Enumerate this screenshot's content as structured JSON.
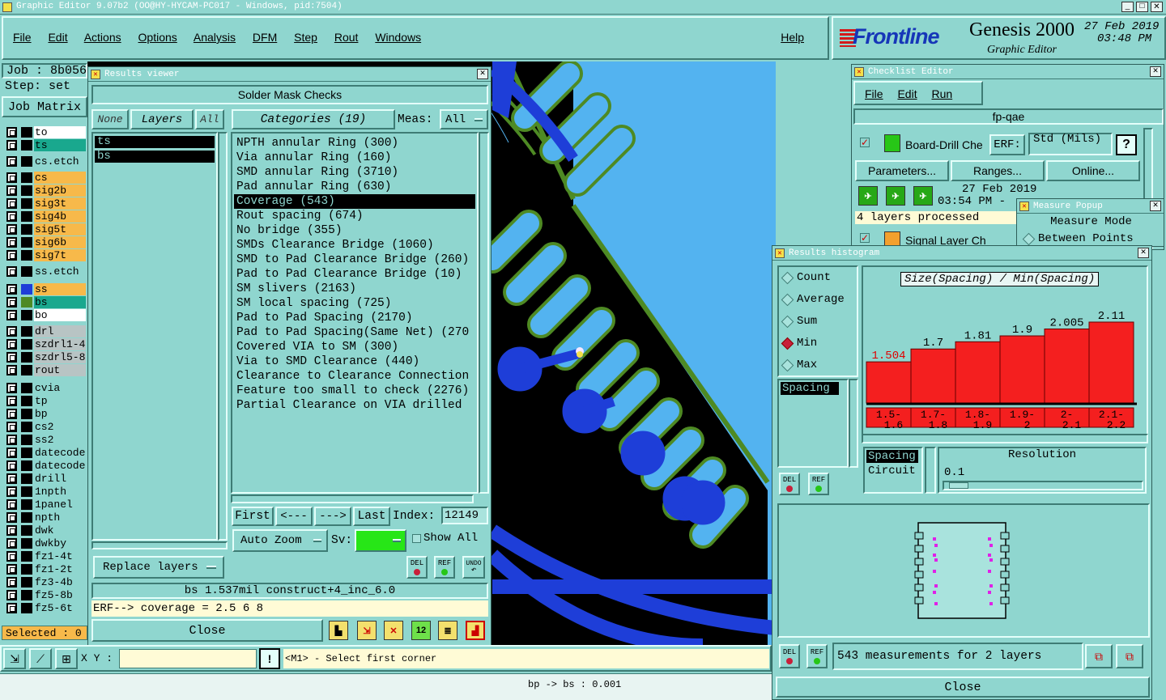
{
  "window_title": "Graphic Editor 9.07b2 (OO@HY-HYCAM-PC017 - Windows, pid:7504)",
  "menu": [
    "File",
    "Edit",
    "Actions",
    "Options",
    "Analysis",
    "DFM",
    "Step",
    "Rout",
    "Windows"
  ],
  "help": "Help",
  "brand": {
    "logo": "Frontline",
    "product": "Genesis 2000",
    "subtitle": "Graphic Editor",
    "date": "27 Feb 2019",
    "time": "03:48 PM"
  },
  "left": {
    "job": "Job : 8b056",
    "step": "Step: set",
    "job_matrix": "Job Matrix",
    "selected": "Selected : 0"
  },
  "layers": [
    {
      "name": "to",
      "color": "#ffffff",
      "swatch": "#000000"
    },
    {
      "name": "ts",
      "color": "#19a88e",
      "swatch": "#000000"
    },
    {
      "name": "cs.etch",
      "color": "#8fd6cf",
      "swatch": "#000000"
    },
    {
      "name": "cs",
      "color": "#f7b94a",
      "swatch": "#000000"
    },
    {
      "name": "sig2b",
      "color": "#f7b94a",
      "swatch": "#000000"
    },
    {
      "name": "sig3t",
      "color": "#f7b94a",
      "swatch": "#000000"
    },
    {
      "name": "sig4b",
      "color": "#f7b94a",
      "swatch": "#000000"
    },
    {
      "name": "sig5t",
      "color": "#f7b94a",
      "swatch": "#000000"
    },
    {
      "name": "sig6b",
      "color": "#f7b94a",
      "swatch": "#000000"
    },
    {
      "name": "sig7t",
      "color": "#f7b94a",
      "swatch": "#000000"
    },
    {
      "name": "ss.etch",
      "color": "#8fd6cf",
      "swatch": "#000000"
    },
    {
      "name": "ss",
      "color": "#f7b94a",
      "swatch": "#1e3ed8"
    },
    {
      "name": "bs",
      "color": "#19a88e",
      "swatch": "#4e8a24"
    },
    {
      "name": "bo",
      "color": "#ffffff",
      "swatch": "#000000"
    },
    {
      "name": "drl",
      "color": "#b8c4c4",
      "swatch": "#000000"
    },
    {
      "name": "szdrl1-4",
      "color": "#b8c4c4",
      "swatch": "#000000"
    },
    {
      "name": "szdrl5-8",
      "color": "#b8c4c4",
      "swatch": "#000000"
    },
    {
      "name": "rout",
      "color": "#b8c4c4",
      "swatch": "#000000"
    },
    {
      "name": "cvia",
      "color": "#8fd6cf",
      "swatch": "#000000"
    },
    {
      "name": "tp",
      "color": "#8fd6cf",
      "swatch": "#000000"
    },
    {
      "name": "bp",
      "color": "#8fd6cf",
      "swatch": "#000000"
    },
    {
      "name": "cs2",
      "color": "#8fd6cf",
      "swatch": "#000000"
    },
    {
      "name": "ss2",
      "color": "#8fd6cf",
      "swatch": "#000000"
    },
    {
      "name": "datecode-",
      "color": "#8fd6cf",
      "swatch": "#000000"
    },
    {
      "name": "datecode-",
      "color": "#8fd6cf",
      "swatch": "#000000"
    },
    {
      "name": "drill",
      "color": "#8fd6cf",
      "swatch": "#000000"
    },
    {
      "name": "1npth",
      "color": "#8fd6cf",
      "swatch": "#000000"
    },
    {
      "name": "1panel",
      "color": "#8fd6cf",
      "swatch": "#000000"
    },
    {
      "name": "npth",
      "color": "#8fd6cf",
      "swatch": "#000000"
    },
    {
      "name": "dwk",
      "color": "#8fd6cf",
      "swatch": "#000000"
    },
    {
      "name": "dwkby",
      "color": "#8fd6cf",
      "swatch": "#000000"
    },
    {
      "name": "fz1-4t",
      "color": "#8fd6cf",
      "swatch": "#000000"
    },
    {
      "name": "fz1-2t",
      "color": "#8fd6cf",
      "swatch": "#000000"
    },
    {
      "name": "fz3-4b",
      "color": "#8fd6cf",
      "swatch": "#000000"
    },
    {
      "name": "fz5-8b",
      "color": "#8fd6cf",
      "swatch": "#000000"
    },
    {
      "name": "fz5-6t",
      "color": "#8fd6cf",
      "swatch": "#000000"
    }
  ],
  "results_viewer": {
    "title": "Results viewer",
    "header": "Solder Mask Checks",
    "none": "None",
    "layers": "Layers",
    "all": "All",
    "categories": "Categories (19)",
    "meas": "Meas:",
    "meas_value": "All",
    "layer_list": [
      "ts",
      "bs"
    ],
    "category_list": [
      "NPTH annular Ring (300)",
      "Via annular Ring (160)",
      "SMD annular Ring (3710)",
      "Pad annular Ring (630)",
      "Coverage (543)",
      "Rout spacing (674)",
      "No bridge (355)",
      "SMDs Clearance Bridge (1060)",
      "SMD to Pad Clearance Bridge (260)",
      "Pad to Pad Clearance Bridge (10)",
      "SM slivers (2163)",
      "SM local spacing (725)",
      "Pad to Pad Spacing (2170)",
      "Pad to Pad Spacing(Same Net) (270",
      "Covered VIA to SM (300)",
      "Via to SMD Clearance (440)",
      "Clearance to Clearance Connection",
      "Feature too small to check (2276)",
      "Partial Clearance on VIA drilled"
    ],
    "first": "First",
    "prev": "<---",
    "next": "--->",
    "last": "Last",
    "index_label": "Index:",
    "index_value": "12149",
    "auto_zoom": "Auto Zoom",
    "sv": "Sv:",
    "show_all": "Show All",
    "replace_layers": "Replace layers",
    "del": "DEL",
    "ref": "REF",
    "undo": "UNDO",
    "status": "bs 1.537mil  construct+4_inc_6.0",
    "erf": "ERF--> coverage = 2.5 6 8",
    "close": "Close"
  },
  "checklist": {
    "title": "Checklist Editor",
    "menu": [
      "File",
      "Edit",
      "Run"
    ],
    "name": "fp-qae",
    "check1": "Board-Drill Che",
    "erf": "ERF:",
    "erf_value": "Std (Mils)",
    "help": "?",
    "parameters": "Parameters...",
    "ranges": "Ranges...",
    "online": "Online...",
    "date": "27 Feb 2019",
    "time": "03:54 PM -",
    "processed": "4 layers processed",
    "check2": "Signal Layer Ch"
  },
  "measure": {
    "title": "Measure Popup",
    "mode": "Measure Mode",
    "between": "Between Points"
  },
  "histogram": {
    "title": "Results histogram",
    "radios": [
      "Count",
      "Average",
      "Sum",
      "Min",
      "Max"
    ],
    "selected": "Min",
    "list": [
      "Spacing"
    ],
    "chart_title": "Size(Spacing) / Min(Spacing)",
    "list2": [
      "Spacing",
      "Circuit"
    ],
    "resolution_label": "Resolution",
    "resolution_value": "0.1",
    "del": "DEL",
    "ref": "REF",
    "footer": "543 measurements for 2 layers",
    "close": "Close"
  },
  "chart_data": {
    "type": "bar",
    "title": "Size(Spacing) / Min(Spacing)",
    "categories": [
      "1.5-1.6",
      "1.7-1.8",
      "1.8-1.9",
      "1.9-2",
      "2-2.1",
      "2.1-2.2"
    ],
    "values": [
      1.504,
      1.7,
      1.81,
      1.9,
      2.005,
      2.11
    ],
    "value_labels": [
      "1.504",
      "1.7",
      "1.81",
      "1.9",
      "2.005",
      "2.11"
    ],
    "colors": {
      "bar": "#f41f1f",
      "highlight_label": "#e00000"
    }
  },
  "bottom": {
    "xy": "X Y :",
    "hint": "<M1> - Select first corner",
    "status": "bp -> bs : 0.001"
  },
  "colors": {
    "bg": "#8fd6cf",
    "board_blue": "#1e3ed8",
    "pad_light": "#53b3f0",
    "mask_green": "#4e8a24"
  }
}
